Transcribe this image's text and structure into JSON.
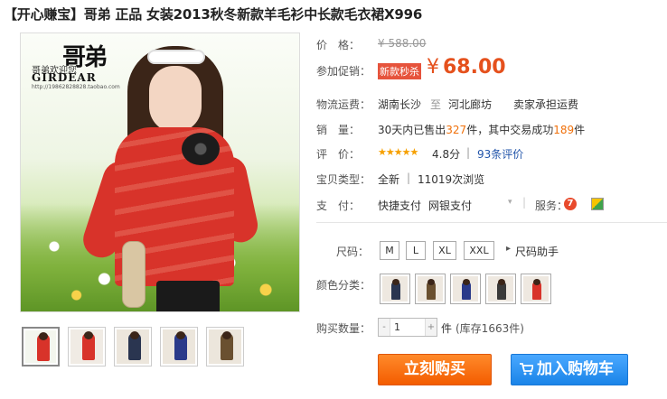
{
  "title": "【开心赚宝】哥弟 正品 女装2013秋冬新款羊毛衫中长款毛衣裙X996",
  "image": {
    "logo_calligraphy": "哥弟",
    "logo_welcome": "哥弟欢迎您",
    "logo_brand": "GIRDEAR",
    "logo_url": "http://19862828828.taobao.com"
  },
  "thumbnails": [
    {
      "color": "#d8332a"
    },
    {
      "color": "#d8332a"
    },
    {
      "color": "#2a3550"
    },
    {
      "color": "#2a3a8a"
    },
    {
      "color": "#6a5030"
    }
  ],
  "price": {
    "label": "价　格：",
    "original": "¥ 588.00"
  },
  "promo": {
    "label": "参加促销：",
    "tag": "新款秒杀",
    "yen": "¥",
    "price": "68.00"
  },
  "shipping": {
    "label": "物流运费：",
    "from": "湖南长沙",
    "sep": "至",
    "to": "河北廊坊",
    "fee": "卖家承担运费"
  },
  "sales": {
    "label": "销　量：",
    "prefix": "30天内已售出",
    "sold": "327",
    "mid": "件，其中交易成功",
    "success": "189",
    "suffix": "件"
  },
  "rating": {
    "label": "评　价：",
    "stars": "★★★★★",
    "score": "4.8分",
    "sep": "|",
    "reviews": "93条评价"
  },
  "item_type": {
    "label": "宝贝类型：",
    "type": "全新",
    "sep": "|",
    "views": "11019次浏览"
  },
  "payment": {
    "label": "支　付：",
    "method1": "快捷支付",
    "method2": "网银支付",
    "service_label": "服务：",
    "service_icon1": "7"
  },
  "size": {
    "label": "尺码：",
    "options": [
      "M",
      "L",
      "XL",
      "XXL"
    ],
    "helper": "尺码助手"
  },
  "colors": {
    "label": "颜色分类：",
    "swatches": [
      {
        "color": "#2a3550"
      },
      {
        "color": "#6a5030"
      },
      {
        "color": "#2a3a8a"
      },
      {
        "color": "#3a3a3a"
      },
      {
        "color": "#d8332a"
      }
    ]
  },
  "quantity": {
    "label": "购买数量：",
    "minus": "-",
    "value": "1",
    "plus": "+",
    "unit": "件",
    "stock": "(库存1663件)"
  },
  "buttons": {
    "buy": "立刻购买",
    "cart": "加入购物车"
  }
}
